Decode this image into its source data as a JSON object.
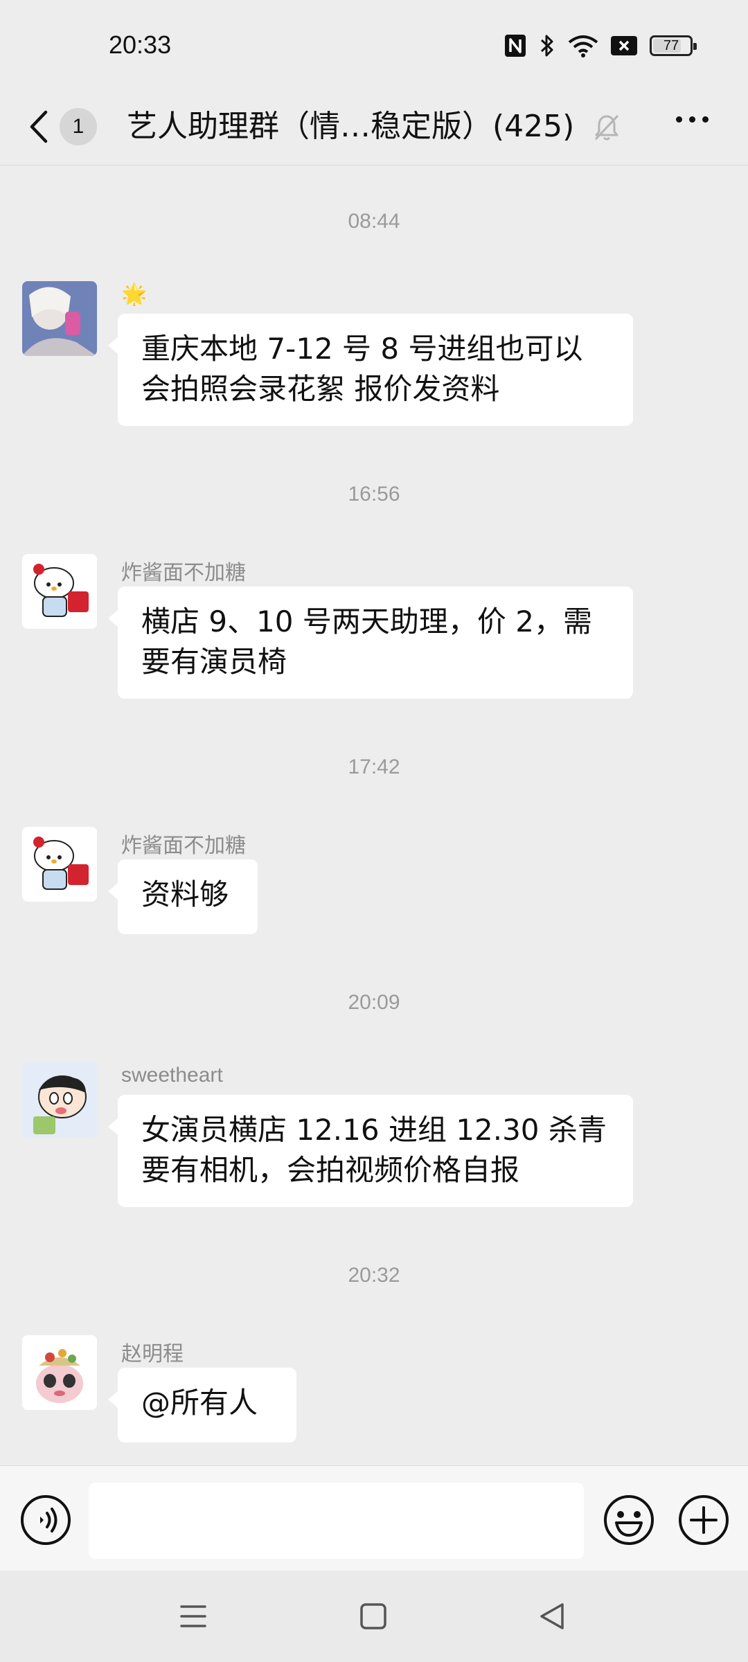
{
  "status_bar": {
    "time": "20:33",
    "battery": "77",
    "battery_level": 0.77
  },
  "header": {
    "back_count": "1",
    "title": "艺人助理群（情…稳定版）(425)"
  },
  "messages": [
    {
      "timestamp": "08:44",
      "sender": "🌟",
      "lines": [
        "重庆本地 7-12 号  8 号进组也可以",
        "会拍照会录花絮  报价发资料"
      ]
    },
    {
      "timestamp": "16:56",
      "sender": "炸酱面不加糖",
      "lines": [
        "横店 9、10 号两天助理，价 2，需",
        "要有演员椅"
      ]
    },
    {
      "timestamp": "17:42",
      "sender": "炸酱面不加糖",
      "lines": [
        "资料够"
      ]
    },
    {
      "timestamp": "20:09",
      "sender": "sweetheart",
      "lines": [
        "女演员横店 12.16 进组 12.30 杀青",
        "要有相机，会拍视频价格自报"
      ]
    },
    {
      "timestamp": "20:32",
      "sender": "赵明程",
      "lines": [
        "@所有人"
      ]
    }
  ],
  "input": {
    "value": "",
    "placeholder": ""
  },
  "icons": {
    "back": "chevron-left-icon",
    "mute": "bell-off-icon",
    "more": "more-icon",
    "voice": "voice-icon",
    "emoji": "smile-icon",
    "plus": "plus-icon",
    "nav_menu": "menu-icon",
    "nav_home": "home-icon",
    "nav_back": "back-triangle-icon"
  },
  "colors": {
    "background": "#ededed",
    "bubble": "#ffffff",
    "timestamp": "#9a9a9a",
    "sender": "#8c8c8c"
  }
}
